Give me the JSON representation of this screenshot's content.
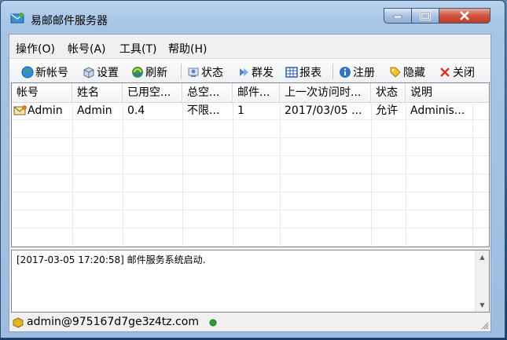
{
  "window": {
    "title": "易邮邮件服务器"
  },
  "menu": [
    "操作(O)",
    "帐号(A)",
    "工具(T)",
    "帮助(H)"
  ],
  "toolbar": [
    {
      "label": "新帐号",
      "icon": "globe-icon"
    },
    {
      "label": "设置",
      "icon": "box-icon"
    },
    {
      "label": "刷新",
      "icon": "refresh-icon"
    },
    {
      "label": "状态",
      "icon": "status-icon"
    },
    {
      "label": "群发",
      "icon": "send-icon"
    },
    {
      "label": "报表",
      "icon": "report-icon"
    },
    {
      "label": "注册",
      "icon": "info-icon"
    },
    {
      "label": "隐藏",
      "icon": "tag-icon"
    },
    {
      "label": "关闭",
      "icon": "close-x-icon"
    }
  ],
  "table": {
    "columns": [
      "帐号",
      "姓名",
      "已用空...",
      "总空...",
      "邮件...",
      "上一次访问时...",
      "状态",
      "说明"
    ],
    "rows": [
      [
        "Admin",
        "Admin",
        "0.4",
        "不限...",
        "1",
        "2017/03/05 ...",
        "允许",
        "Adminis..."
      ]
    ]
  },
  "log": {
    "lines": [
      "[2017-03-05 17:20:58] 邮件服务系统启动."
    ]
  },
  "status": {
    "text": "admin@975167d7ge3z4tz.com",
    "online_color": "#2aa52a"
  }
}
